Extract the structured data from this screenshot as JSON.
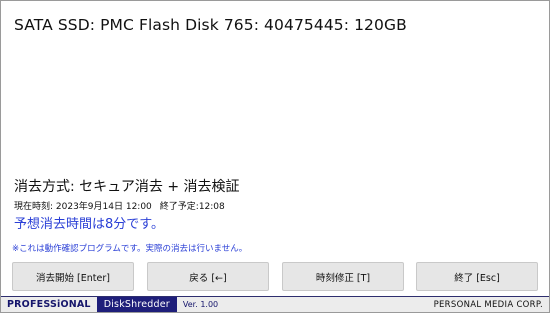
{
  "disk": {
    "title": "SATA SSD: PMC Flash Disk 765: 40475445: 120GB"
  },
  "erase": {
    "method": "消去方式: セキュア消去 + 消去検証",
    "current_time": "現在時刻: 2023年9月14日 12:00",
    "end_time": "終了予定:12:08",
    "estimate": "予想消去時間は8分です。",
    "notice": "※これは動作確認プログラムです。実際の消去は行いません。"
  },
  "buttons": {
    "start": "消去開始 [Enter]",
    "back": "戻る [←]",
    "adjust_time": "時刻修正 [T]",
    "quit": "終了 [Esc]"
  },
  "footer": {
    "professional": "PROFESSiONAL",
    "product": "DiskShredder",
    "version": "Ver. 1.00",
    "company": "PERSONAL MEDIA CORP."
  },
  "colors": {
    "accent_blue": "#2a3fd6",
    "footer_navy": "#1e1e7a",
    "button_bg": "#e6e6e6"
  }
}
